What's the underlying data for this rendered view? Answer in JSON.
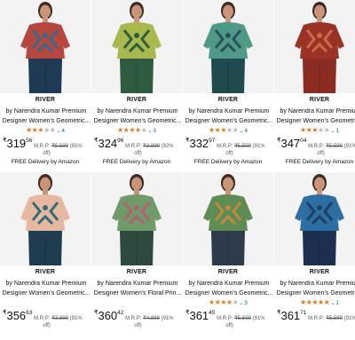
{
  "products": [
    {
      "brand": "RIVER",
      "title_line1": "by Narendra Kumar Premium",
      "title_line2": "Designer Women's Geometric...",
      "stars": 3,
      "rating_count": "4",
      "price_whole": "319",
      "price_fraction": "56",
      "mrp_label": "M.R.P:",
      "mrp": "₹5,599",
      "discount_open": "(91%",
      "discount_close": "off)",
      "delivery": "FREE Delivery by Amazon",
      "colors": {
        "top": "#b5473f",
        "pattern": "#2f6b8c",
        "pants": "#1e3a55"
      }
    },
    {
      "brand": "RIVER",
      "title_line1": "by Narendra Kumar Premium",
      "title_line2": "Designer Women's Geometric...",
      "stars": 4,
      "rating_count": "3",
      "price_whole": "324",
      "price_fraction": "96",
      "mrp_label": "M.R.P:",
      "mrp": "₹3,899",
      "discount_open": "(92%",
      "discount_close": "off)",
      "delivery": "FREE Delivery by Amazon",
      "colors": {
        "top": "#a9b84e",
        "pattern": "#2e5e3c",
        "pants": "#2f5c40"
      }
    },
    {
      "brand": "RIVER",
      "title_line1": "by Narendra Kumar Premium",
      "title_line2": "Designer Women's Geometric...",
      "stars": 3,
      "rating_count": "4",
      "price_whole": "332",
      "price_fraction": "97",
      "mrp_label": "M.R.P:",
      "mrp": "₹5,599",
      "discount_open": "(91%",
      "discount_close": "off)",
      "delivery": "FREE Delivery by Amazon",
      "colors": {
        "top": "#4f9a86",
        "pattern": "#2b4f5c",
        "pants": "#1f4a4e"
      }
    },
    {
      "brand": "RIVER",
      "title_line1": "by Narendra Kumar Premium",
      "title_line2": "Designer Women's Geometric...",
      "stars": 3,
      "rating_count": "1",
      "price_whole": "347",
      "price_fraction": "04",
      "mrp_label": "M.R.P:",
      "mrp": "₹5,599",
      "discount_open": "(91%",
      "discount_close": "off)",
      "delivery": "FREE Delivery by Amazon",
      "colors": {
        "top": "#9b3226",
        "pattern": "#c86a4c",
        "pants": "#8a2c22"
      }
    },
    {
      "brand": "RIVER",
      "title_line1": "by Narendra Kumar Premium",
      "title_line2": "Designer Women's Geometric...",
      "stars": 0,
      "rating_count": "",
      "price_whole": "356",
      "price_fraction": "63",
      "mrp_label": "M.R.P:",
      "mrp": "₹3,899",
      "discount_open": "(91%",
      "discount_close": "off)",
      "delivery": "",
      "colors": {
        "top": "#e7b79f",
        "pattern": "#2c6f7a",
        "pants": "#1f3d50"
      }
    },
    {
      "brand": "RIVER",
      "title_line1": "by Narendra Kumar Premium",
      "title_line2": "Designer Women's Floral Prin...",
      "stars": 0,
      "rating_count": "",
      "price_whole": "360",
      "price_fraction": "42",
      "mrp_label": "M.R.P:",
      "mrp": "₹4,899",
      "discount_open": "(91%",
      "discount_close": "off)",
      "delivery": "",
      "colors": {
        "top": "#6f9a6a",
        "pattern": "#b45f72",
        "pants": "#2e4a3e"
      }
    },
    {
      "brand": "RIVER",
      "title_line1": "by Narendra Kumar Premium",
      "title_line2": "Designer Women's Geometric...",
      "stars": 4,
      "rating_count": "5",
      "price_whole": "361",
      "price_fraction": "45",
      "mrp_label": "M.R.P:",
      "mrp": "₹5,599",
      "discount_open": "(91%",
      "discount_close": "off)",
      "delivery": "",
      "colors": {
        "top": "#5f8c55",
        "pattern": "#c48a3c",
        "pants": "#2c3c4a"
      }
    },
    {
      "brand": "RIVER",
      "title_line1": "by Narendra Kumar Premium",
      "title_line2": "Designer Women's Geometric...",
      "stars": 5,
      "rating_count": "1",
      "price_whole": "361",
      "price_fraction": "71",
      "mrp_label": "M.R.P:",
      "mrp": "₹5,599",
      "discount_open": "(91%",
      "discount_close": "",
      "delivery": "",
      "colors": {
        "top": "#2d6fa3",
        "pattern": "#1c3f66",
        "pants": "#1d2f4f"
      }
    }
  ],
  "currency_symbol": "₹",
  "rating_chevron": "⌄",
  "star_filled": "★",
  "star_empty": "★"
}
